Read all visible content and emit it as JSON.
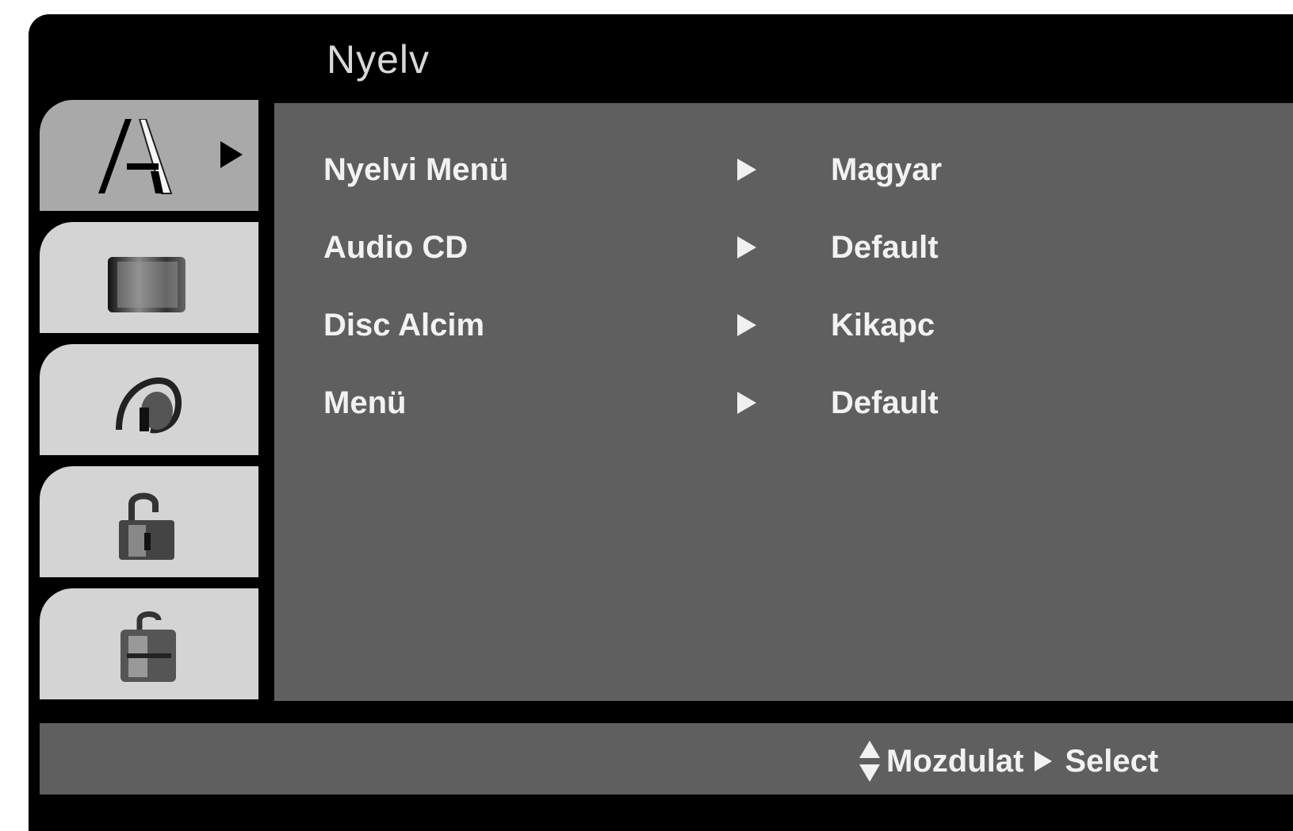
{
  "header": {
    "title": "Nyelv"
  },
  "sidebar": {
    "tabs": [
      {
        "icon": "language-icon",
        "active": true
      },
      {
        "icon": "display-icon",
        "active": false
      },
      {
        "icon": "audio-icon",
        "active": false
      },
      {
        "icon": "lock-icon",
        "active": false
      },
      {
        "icon": "other-icon",
        "active": false
      }
    ]
  },
  "menu": {
    "rows": [
      {
        "label": "Nyelvi Menü",
        "value": "Magyar"
      },
      {
        "label": "Audio CD",
        "value": "Default"
      },
      {
        "label": "Disc Alcim",
        "value": "Kikapc"
      },
      {
        "label": "Menü",
        "value": "Default"
      }
    ]
  },
  "footer": {
    "move_label": "Mozdulat",
    "select_label": "Select"
  },
  "colors": {
    "background": "#000000",
    "panel": "#5f5f5f",
    "tab": "#d4d4d4",
    "tab_active": "#a9a9a9",
    "text": "#f2f2f2"
  }
}
